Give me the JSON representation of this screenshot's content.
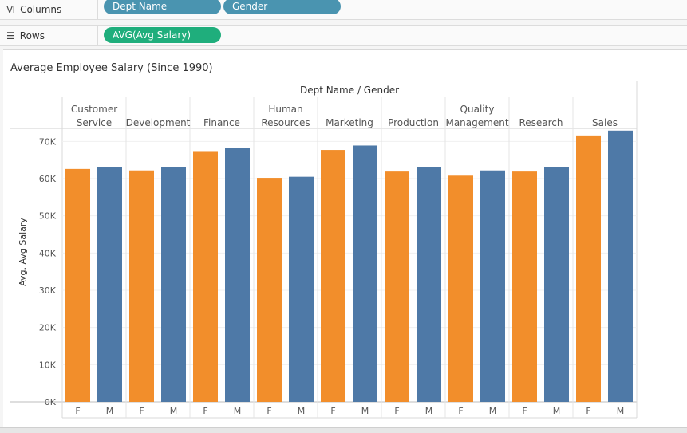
{
  "shelves": {
    "columns": {
      "label": "Columns",
      "icon": "columns-icon",
      "pills": [
        "Dept Name",
        "Gender"
      ]
    },
    "rows": {
      "label": "Rows",
      "icon": "rows-icon",
      "pills": [
        "AVG(Avg Salary)"
      ]
    }
  },
  "colors": {
    "pill_dimension": "#4a94b0",
    "pill_measure": "#1fae7c",
    "female": "#f28e2b",
    "male": "#4e79a7"
  },
  "chart_data": {
    "type": "bar",
    "title": "Average Employee Salary (Since 1990)",
    "column_header": "Dept Name / Gender",
    "ylabel": "Avg. Avg Salary",
    "ylim": [
      0,
      73500
    ],
    "yticks": [
      0,
      10000,
      20000,
      30000,
      40000,
      50000,
      60000,
      70000
    ],
    "ytick_labels": [
      "0K",
      "10K",
      "20K",
      "30K",
      "40K",
      "50K",
      "60K",
      "70K"
    ],
    "groups": [
      {
        "name": [
          "Customer",
          "Service"
        ],
        "values": {
          "F": 62600,
          "M": 63000
        }
      },
      {
        "name": [
          "Development"
        ],
        "values": {
          "F": 62200,
          "M": 63000
        }
      },
      {
        "name": [
          "Finance"
        ],
        "values": {
          "F": 67400,
          "M": 68200
        }
      },
      {
        "name": [
          "Human",
          "Resources"
        ],
        "values": {
          "F": 60200,
          "M": 60500
        }
      },
      {
        "name": [
          "Marketing"
        ],
        "values": {
          "F": 67700,
          "M": 68900
        }
      },
      {
        "name": [
          "Production"
        ],
        "values": {
          "F": 61900,
          "M": 63200
        }
      },
      {
        "name": [
          "Quality",
          "Management"
        ],
        "values": {
          "F": 60800,
          "M": 62200
        }
      },
      {
        "name": [
          "Research"
        ],
        "values": {
          "F": 61900,
          "M": 63000
        }
      },
      {
        "name": [
          "Sales"
        ],
        "values": {
          "F": 71600,
          "M": 72900
        }
      }
    ],
    "categories": [
      "F",
      "M"
    ]
  }
}
